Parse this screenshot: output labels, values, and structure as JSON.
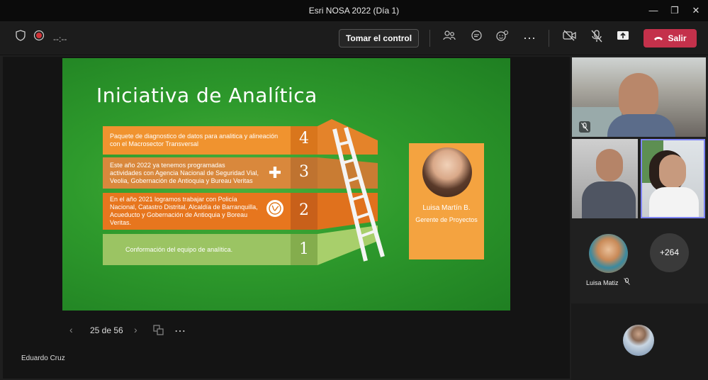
{
  "window": {
    "title": "Esri NOSA 2022 (Día 1)",
    "minimize": "—",
    "maximize": "❐",
    "close": "✕"
  },
  "toolbar": {
    "timer": "--:--",
    "take_control": "Tomar el control",
    "leave": "Salir",
    "icons": {
      "shield": "shield-icon",
      "record": "record-icon",
      "people": "people-icon",
      "chat": "chat-icon",
      "react": "reactions-icon",
      "more": "more-icon",
      "camera": "camera-off-icon",
      "mic": "mic-off-icon",
      "share": "share-icon",
      "phone": "phone-icon"
    }
  },
  "slide": {
    "title": "Iniciativa de Analítica",
    "steps": [
      {
        "num": "4",
        "text": "Paquete de diagnostico de datos para analitica y alineación con el Macrosector Transversal"
      },
      {
        "num": "3",
        "text": "Este año 2022 ya tenemos programadas actividades con Agencia Nacional de Seguridad Vial, Veolia, Gobernación de Antioquia y Bureau Veritas"
      },
      {
        "num": "2",
        "text": "En el año 2021 logramos trabajar con Policía Nacional, Catastro Distrital, Alcaldía de Barranquilla, Acueducto y Gobernación de Antioquia y Boreau Veritas."
      },
      {
        "num": "1",
        "text": "Conformación del equipo de analítica."
      }
    ],
    "card": {
      "name": "Luisa Martín B.",
      "role": "Gerente de Proyectos"
    },
    "colors": {
      "orange": "#f4a340",
      "orange_dark": "#e77a1f",
      "green_light": "#9bc463",
      "bg_green": "#2e9a2c"
    }
  },
  "nav": {
    "prev": "‹",
    "next": "›",
    "page": "25 de 56",
    "more": "⋯"
  },
  "presenter": {
    "name": "Eduardo Cruz"
  },
  "participants": {
    "named": "Luisa Matiz",
    "overflow": "+264"
  }
}
